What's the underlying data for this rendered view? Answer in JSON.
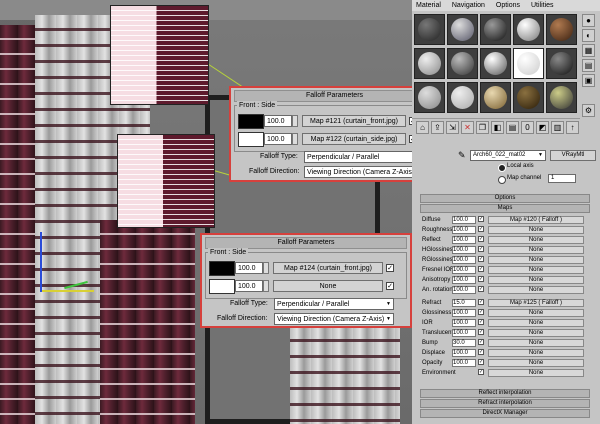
{
  "material_editor": {
    "menu": [
      "Material",
      "Navigation",
      "Options",
      "Utilities"
    ],
    "material_name": "Arch60_022_mat02",
    "material_type": "VRayMtl",
    "coord_options": [
      "Local axis",
      "Map channel"
    ],
    "map_channel_value": "1",
    "rollouts": [
      "Options",
      "Maps"
    ],
    "maps": [
      {
        "name": "Diffuse",
        "value": "100.0",
        "checked": true,
        "map": "Map #120  ( Falloff )"
      },
      {
        "name": "Roughness",
        "value": "100.0",
        "checked": true,
        "map": "None"
      },
      {
        "name": "Reflect",
        "value": "100.0",
        "checked": true,
        "map": "None"
      },
      {
        "name": "HGlossiness",
        "value": "100.0",
        "checked": true,
        "map": "None"
      },
      {
        "name": "RGlossiness",
        "value": "100.0",
        "checked": true,
        "map": "None"
      },
      {
        "name": "Fresnel IOR",
        "value": "100.0",
        "checked": true,
        "map": "None"
      },
      {
        "name": "Anisotropy",
        "value": "100.0",
        "checked": true,
        "map": "None"
      },
      {
        "name": "An. rotation",
        "value": "100.0",
        "checked": true,
        "map": "None"
      },
      {
        "name": "Refract",
        "value": "15.0",
        "checked": true,
        "map": "Map #125  ( Falloff )"
      },
      {
        "name": "Glossiness",
        "value": "100.0",
        "checked": true,
        "map": "None"
      },
      {
        "name": "IOR",
        "value": "100.0",
        "checked": true,
        "map": "None"
      },
      {
        "name": "Translucent",
        "value": "100.0",
        "checked": true,
        "map": "None"
      },
      {
        "name": "Bump",
        "value": "30.0",
        "checked": true,
        "map": "None"
      },
      {
        "name": "Displace",
        "value": "100.0",
        "checked": true,
        "map": "None"
      },
      {
        "name": "Opacity",
        "value": "100.0",
        "checked": true,
        "map": "None"
      },
      {
        "name": "Environment",
        "value": "",
        "checked": true,
        "map": "None"
      }
    ],
    "bottom_rollouts": [
      "Reflect interpolation",
      "Refract interpolation",
      "DirectX Manager"
    ]
  },
  "falloff_top": {
    "title": "Falloff Parameters",
    "group_label": "Front : Side",
    "rows": [
      {
        "value": "100.0",
        "map": "Map #121 (curtain_front.jpg)",
        "checked": true
      },
      {
        "value": "100.0",
        "map": "Map #122 (curtain_side.jpg)",
        "checked": true
      }
    ],
    "falloff_type_label": "Falloff Type:",
    "falloff_type_value": "Perpendicular / Parallel",
    "falloff_direction_label": "Falloff Direction:",
    "falloff_direction_value": "Viewing Direction (Camera Z-Axis)"
  },
  "falloff_bottom": {
    "title": "Falloff Parameters",
    "group_label": "Front : Side",
    "rows": [
      {
        "value": "100.0",
        "map": "Map #124 (curtain_front.jpg)",
        "checked": true
      },
      {
        "value": "100.0",
        "map": "None",
        "checked": true
      }
    ],
    "falloff_type_label": "Falloff Type:",
    "falloff_type_value": "Perpendicular / Parallel",
    "falloff_direction_label": "Falloff Direction:",
    "falloff_direction_value": "Viewing Direction (Camera Z-Axis)"
  },
  "colors": {
    "accent_border": "#d6403c",
    "connector": "#b7d33a",
    "curtain_dark": "#5e1a2d",
    "curtain_light": "#f6dde3"
  }
}
